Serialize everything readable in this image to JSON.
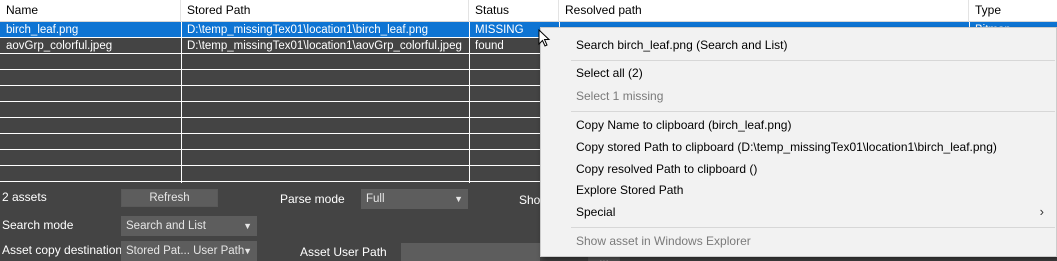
{
  "table": {
    "columns": [
      "Name",
      "Stored Path",
      "Status",
      "Resolved path",
      "Type"
    ],
    "rows": [
      {
        "name": "birch_leaf.png",
        "stored_path": "D:\\temp_missingTex01\\location1\\birch_leaf.png",
        "status": "MISSING",
        "resolved_path": "",
        "type": "Bitmap"
      },
      {
        "name": "aovGrp_colorful.jpeg",
        "stored_path": "D:\\temp_missingTex01\\location1\\aovGrp_colorful.jpeg",
        "status": "found",
        "resolved_path": "",
        "type": ""
      }
    ],
    "selected_row": 0,
    "empty_rows": 8
  },
  "panel": {
    "asset_count": "2 assets",
    "refresh_label": "Refresh",
    "parse_mode_label": "Parse mode",
    "parse_mode_value": "Full",
    "show_label": "Show",
    "search_mode_label": "Search mode",
    "search_mode_value": "Search and List",
    "asset_copy_label": "Asset copy destination",
    "asset_copy_value": "Stored Pat... User Path",
    "asset_user_path_label": "Asset User Path",
    "browse_label": "..."
  },
  "context_menu": {
    "items": [
      {
        "label": "Search birch_leaf.png (Search and List)",
        "enabled": true
      },
      {
        "label": "Select all (2)",
        "enabled": true
      },
      {
        "label": "Select 1 missing",
        "enabled": false
      },
      {
        "label": "Copy Name to clipboard (birch_leaf.png)",
        "enabled": true
      },
      {
        "label": "Copy stored Path to clipboard (D:\\temp_missingTex01\\location1\\birch_leaf.png)",
        "enabled": true
      },
      {
        "label": "Copy resolved Path to clipboard ()",
        "enabled": true
      },
      {
        "label": "Explore Stored Path",
        "enabled": true
      },
      {
        "label": "Special",
        "enabled": true,
        "submenu": true
      },
      {
        "label": "Show asset in Windows Explorer",
        "enabled": false
      }
    ]
  },
  "colors": {
    "selection": "#0e74d3",
    "panel_background": "#444444",
    "menu_background": "#f2f2f2",
    "disabled_text": "#7a7a7a"
  },
  "icons": {
    "combo_arrow": "dropdown-arrow-icon",
    "submenu_arrow": "chevron-right-icon",
    "cursor": "mouse-pointer-icon"
  }
}
